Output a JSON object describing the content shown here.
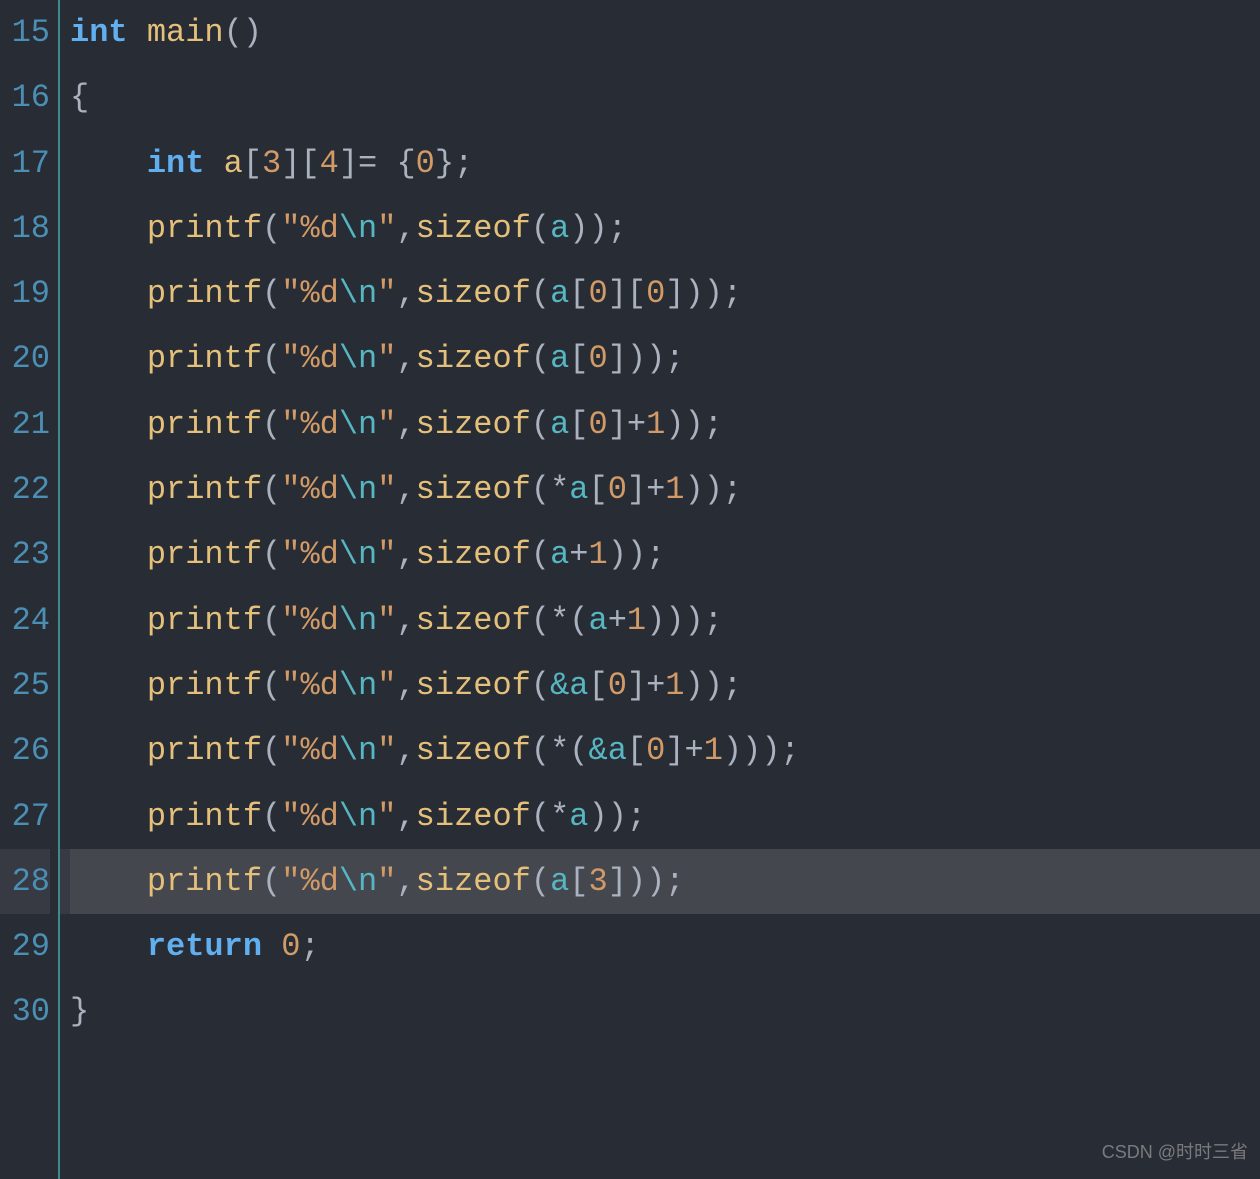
{
  "editor": {
    "startLine": 15,
    "highlightedLine": 28,
    "lines": [
      {
        "num": 15,
        "tokens": [
          {
            "t": "int",
            "c": "tok-type"
          },
          {
            "t": " ",
            "c": ""
          },
          {
            "t": "main",
            "c": "tok-func"
          },
          {
            "t": "()",
            "c": "tok-paren"
          }
        ]
      },
      {
        "num": 16,
        "tokens": [
          {
            "t": "{",
            "c": "tok-brace"
          }
        ]
      },
      {
        "num": 17,
        "tokens": [
          {
            "t": "    ",
            "c": ""
          },
          {
            "t": "int",
            "c": "tok-type"
          },
          {
            "t": " ",
            "c": ""
          },
          {
            "t": "a",
            "c": "tok-ident"
          },
          {
            "t": "[",
            "c": "tok-bracket"
          },
          {
            "t": "3",
            "c": "tok-number"
          },
          {
            "t": "][",
            "c": "tok-bracket"
          },
          {
            "t": "4",
            "c": "tok-number"
          },
          {
            "t": "]",
            "c": "tok-bracket"
          },
          {
            "t": "= ",
            "c": "tok-punct"
          },
          {
            "t": "{",
            "c": "tok-brace"
          },
          {
            "t": "0",
            "c": "tok-number"
          },
          {
            "t": "}",
            "c": "tok-brace"
          },
          {
            "t": ";",
            "c": "tok-semi"
          }
        ]
      },
      {
        "num": 18,
        "tokens": [
          {
            "t": "    ",
            "c": ""
          },
          {
            "t": "printf",
            "c": "tok-ident"
          },
          {
            "t": "(",
            "c": "tok-paren"
          },
          {
            "t": "\"%d",
            "c": "tok-string"
          },
          {
            "t": "\\n",
            "c": "tok-escape"
          },
          {
            "t": "\"",
            "c": "tok-string"
          },
          {
            "t": ",",
            "c": "tok-comma"
          },
          {
            "t": "sizeof",
            "c": "tok-ident"
          },
          {
            "t": "(",
            "c": "tok-paren"
          },
          {
            "t": "a",
            "c": "tok-var"
          },
          {
            "t": "))",
            "c": "tok-paren"
          },
          {
            "t": ";",
            "c": "tok-semi"
          }
        ]
      },
      {
        "num": 19,
        "tokens": [
          {
            "t": "    ",
            "c": ""
          },
          {
            "t": "printf",
            "c": "tok-ident"
          },
          {
            "t": "(",
            "c": "tok-paren"
          },
          {
            "t": "\"%d",
            "c": "tok-string"
          },
          {
            "t": "\\n",
            "c": "tok-escape"
          },
          {
            "t": "\"",
            "c": "tok-string"
          },
          {
            "t": ",",
            "c": "tok-comma"
          },
          {
            "t": "sizeof",
            "c": "tok-ident"
          },
          {
            "t": "(",
            "c": "tok-paren"
          },
          {
            "t": "a",
            "c": "tok-var"
          },
          {
            "t": "[",
            "c": "tok-bracket"
          },
          {
            "t": "0",
            "c": "tok-number"
          },
          {
            "t": "][",
            "c": "tok-bracket"
          },
          {
            "t": "0",
            "c": "tok-number"
          },
          {
            "t": "]))",
            "c": "tok-paren"
          },
          {
            "t": ";",
            "c": "tok-semi"
          }
        ]
      },
      {
        "num": 20,
        "tokens": [
          {
            "t": "    ",
            "c": ""
          },
          {
            "t": "printf",
            "c": "tok-ident"
          },
          {
            "t": "(",
            "c": "tok-paren"
          },
          {
            "t": "\"%d",
            "c": "tok-string"
          },
          {
            "t": "\\n",
            "c": "tok-escape"
          },
          {
            "t": "\"",
            "c": "tok-string"
          },
          {
            "t": ",",
            "c": "tok-comma"
          },
          {
            "t": "sizeof",
            "c": "tok-ident"
          },
          {
            "t": "(",
            "c": "tok-paren"
          },
          {
            "t": "a",
            "c": "tok-var"
          },
          {
            "t": "[",
            "c": "tok-bracket"
          },
          {
            "t": "0",
            "c": "tok-number"
          },
          {
            "t": "]))",
            "c": "tok-paren"
          },
          {
            "t": ";",
            "c": "tok-semi"
          }
        ]
      },
      {
        "num": 21,
        "tokens": [
          {
            "t": "    ",
            "c": ""
          },
          {
            "t": "printf",
            "c": "tok-ident"
          },
          {
            "t": "(",
            "c": "tok-paren"
          },
          {
            "t": "\"%d",
            "c": "tok-string"
          },
          {
            "t": "\\n",
            "c": "tok-escape"
          },
          {
            "t": "\"",
            "c": "tok-string"
          },
          {
            "t": ",",
            "c": "tok-comma"
          },
          {
            "t": "sizeof",
            "c": "tok-ident"
          },
          {
            "t": "(",
            "c": "tok-paren"
          },
          {
            "t": "a",
            "c": "tok-var"
          },
          {
            "t": "[",
            "c": "tok-bracket"
          },
          {
            "t": "0",
            "c": "tok-number"
          },
          {
            "t": "]",
            "c": "tok-bracket"
          },
          {
            "t": "+",
            "c": "tok-plus"
          },
          {
            "t": "1",
            "c": "tok-number"
          },
          {
            "t": "))",
            "c": "tok-paren"
          },
          {
            "t": ";",
            "c": "tok-semi"
          }
        ]
      },
      {
        "num": 22,
        "tokens": [
          {
            "t": "    ",
            "c": ""
          },
          {
            "t": "printf",
            "c": "tok-ident"
          },
          {
            "t": "(",
            "c": "tok-paren"
          },
          {
            "t": "\"%d",
            "c": "tok-string"
          },
          {
            "t": "\\n",
            "c": "tok-escape"
          },
          {
            "t": "\"",
            "c": "tok-string"
          },
          {
            "t": ",",
            "c": "tok-comma"
          },
          {
            "t": "sizeof",
            "c": "tok-ident"
          },
          {
            "t": "(*",
            "c": "tok-paren"
          },
          {
            "t": "a",
            "c": "tok-var"
          },
          {
            "t": "[",
            "c": "tok-bracket"
          },
          {
            "t": "0",
            "c": "tok-number"
          },
          {
            "t": "]",
            "c": "tok-bracket"
          },
          {
            "t": "+",
            "c": "tok-plus"
          },
          {
            "t": "1",
            "c": "tok-number"
          },
          {
            "t": "))",
            "c": "tok-paren"
          },
          {
            "t": ";",
            "c": "tok-semi"
          }
        ]
      },
      {
        "num": 23,
        "tokens": [
          {
            "t": "    ",
            "c": ""
          },
          {
            "t": "printf",
            "c": "tok-ident"
          },
          {
            "t": "(",
            "c": "tok-paren"
          },
          {
            "t": "\"%d",
            "c": "tok-string"
          },
          {
            "t": "\\n",
            "c": "tok-escape"
          },
          {
            "t": "\"",
            "c": "tok-string"
          },
          {
            "t": ",",
            "c": "tok-comma"
          },
          {
            "t": "sizeof",
            "c": "tok-ident"
          },
          {
            "t": "(",
            "c": "tok-paren"
          },
          {
            "t": "a",
            "c": "tok-var"
          },
          {
            "t": "+",
            "c": "tok-plus"
          },
          {
            "t": "1",
            "c": "tok-number"
          },
          {
            "t": "))",
            "c": "tok-paren"
          },
          {
            "t": ";",
            "c": "tok-semi"
          }
        ]
      },
      {
        "num": 24,
        "tokens": [
          {
            "t": "    ",
            "c": ""
          },
          {
            "t": "printf",
            "c": "tok-ident"
          },
          {
            "t": "(",
            "c": "tok-paren"
          },
          {
            "t": "\"%d",
            "c": "tok-string"
          },
          {
            "t": "\\n",
            "c": "tok-escape"
          },
          {
            "t": "\"",
            "c": "tok-string"
          },
          {
            "t": ",",
            "c": "tok-comma"
          },
          {
            "t": "sizeof",
            "c": "tok-ident"
          },
          {
            "t": "(*(",
            "c": "tok-paren"
          },
          {
            "t": "a",
            "c": "tok-var"
          },
          {
            "t": "+",
            "c": "tok-plus"
          },
          {
            "t": "1",
            "c": "tok-number"
          },
          {
            "t": ")))",
            "c": "tok-paren"
          },
          {
            "t": ";",
            "c": "tok-semi"
          }
        ]
      },
      {
        "num": 25,
        "tokens": [
          {
            "t": "    ",
            "c": ""
          },
          {
            "t": "printf",
            "c": "tok-ident"
          },
          {
            "t": "(",
            "c": "tok-paren"
          },
          {
            "t": "\"%d",
            "c": "tok-string"
          },
          {
            "t": "\\n",
            "c": "tok-escape"
          },
          {
            "t": "\"",
            "c": "tok-string"
          },
          {
            "t": ",",
            "c": "tok-comma"
          },
          {
            "t": "sizeof",
            "c": "tok-ident"
          },
          {
            "t": "(",
            "c": "tok-paren"
          },
          {
            "t": "&",
            "c": "tok-amp"
          },
          {
            "t": "a",
            "c": "tok-var"
          },
          {
            "t": "[",
            "c": "tok-bracket"
          },
          {
            "t": "0",
            "c": "tok-number"
          },
          {
            "t": "]",
            "c": "tok-bracket"
          },
          {
            "t": "+",
            "c": "tok-plus"
          },
          {
            "t": "1",
            "c": "tok-number"
          },
          {
            "t": "))",
            "c": "tok-paren"
          },
          {
            "t": ";",
            "c": "tok-semi"
          }
        ]
      },
      {
        "num": 26,
        "tokens": [
          {
            "t": "    ",
            "c": ""
          },
          {
            "t": "printf",
            "c": "tok-ident"
          },
          {
            "t": "(",
            "c": "tok-paren"
          },
          {
            "t": "\"%d",
            "c": "tok-string"
          },
          {
            "t": "\\n",
            "c": "tok-escape"
          },
          {
            "t": "\"",
            "c": "tok-string"
          },
          {
            "t": ",",
            "c": "tok-comma"
          },
          {
            "t": "sizeof",
            "c": "tok-ident"
          },
          {
            "t": "(*(",
            "c": "tok-paren"
          },
          {
            "t": "&",
            "c": "tok-amp"
          },
          {
            "t": "a",
            "c": "tok-var"
          },
          {
            "t": "[",
            "c": "tok-bracket"
          },
          {
            "t": "0",
            "c": "tok-number"
          },
          {
            "t": "]",
            "c": "tok-bracket"
          },
          {
            "t": "+",
            "c": "tok-plus"
          },
          {
            "t": "1",
            "c": "tok-number"
          },
          {
            "t": ")))",
            "c": "tok-paren"
          },
          {
            "t": ";",
            "c": "tok-semi"
          }
        ]
      },
      {
        "num": 27,
        "tokens": [
          {
            "t": "    ",
            "c": ""
          },
          {
            "t": "printf",
            "c": "tok-ident"
          },
          {
            "t": "(",
            "c": "tok-paren"
          },
          {
            "t": "\"%d",
            "c": "tok-string"
          },
          {
            "t": "\\n",
            "c": "tok-escape"
          },
          {
            "t": "\"",
            "c": "tok-string"
          },
          {
            "t": ",",
            "c": "tok-comma"
          },
          {
            "t": "sizeof",
            "c": "tok-ident"
          },
          {
            "t": "(*",
            "c": "tok-paren"
          },
          {
            "t": "a",
            "c": "tok-var"
          },
          {
            "t": "))",
            "c": "tok-paren"
          },
          {
            "t": ";",
            "c": "tok-semi"
          }
        ]
      },
      {
        "num": 28,
        "tokens": [
          {
            "t": "    ",
            "c": ""
          },
          {
            "t": "printf",
            "c": "tok-ident"
          },
          {
            "t": "(",
            "c": "tok-paren"
          },
          {
            "t": "\"%d",
            "c": "tok-string"
          },
          {
            "t": "\\n",
            "c": "tok-escape"
          },
          {
            "t": "\"",
            "c": "tok-string"
          },
          {
            "t": ",",
            "c": "tok-comma"
          },
          {
            "t": "sizeof",
            "c": "tok-ident"
          },
          {
            "t": "(",
            "c": "tok-paren"
          },
          {
            "t": "a",
            "c": "tok-var"
          },
          {
            "t": "[",
            "c": "tok-bracket"
          },
          {
            "t": "3",
            "c": "tok-number"
          },
          {
            "t": "]))",
            "c": "tok-paren"
          },
          {
            "t": ";",
            "c": "tok-semi"
          }
        ]
      },
      {
        "num": 29,
        "tokens": [
          {
            "t": "    ",
            "c": ""
          },
          {
            "t": "return",
            "c": "tok-keyword"
          },
          {
            "t": " ",
            "c": ""
          },
          {
            "t": "0",
            "c": "tok-number"
          },
          {
            "t": ";",
            "c": "tok-semi"
          }
        ]
      },
      {
        "num": 30,
        "tokens": [
          {
            "t": "}",
            "c": "tok-brace"
          }
        ]
      }
    ]
  },
  "watermark": "CSDN @时时三省"
}
